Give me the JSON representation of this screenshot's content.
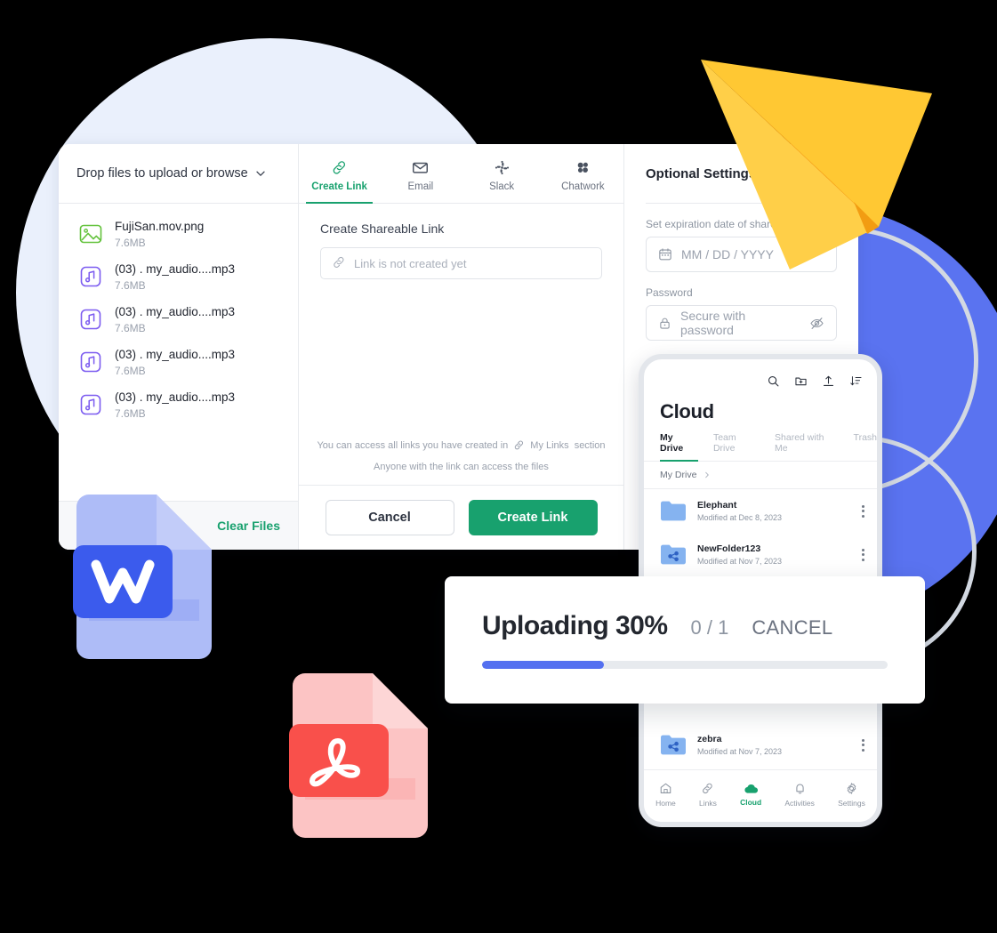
{
  "colors": {
    "brand_green": "#18a16e",
    "progress_blue": "#5470f0",
    "circle_blue": "#5a73f0",
    "circle_light": "#eaf0fc",
    "plane_yellow": "#ffc833",
    "word_blue": "#3b5bed",
    "pdf_red": "#f9504b"
  },
  "upload_panel": {
    "drop_label": "Drop files to upload or browse",
    "clear_files_label": "Clear Files",
    "files": [
      {
        "name": "FujiSan.mov.png",
        "size": "7.6MB",
        "icon": "image-file-icon"
      },
      {
        "name": "(03) . my_audio....mp3",
        "size": "7.6MB",
        "icon": "audio-file-icon"
      },
      {
        "name": "(03) . my_audio....mp3",
        "size": "7.6MB",
        "icon": "audio-file-icon"
      },
      {
        "name": "(03) . my_audio....mp3",
        "size": "7.6MB",
        "icon": "audio-file-icon"
      },
      {
        "name": "(03) . my_audio....mp3",
        "size": "7.6MB",
        "icon": "audio-file-icon"
      }
    ]
  },
  "share_panel": {
    "tabs": [
      {
        "label": "Create Link",
        "icon": "link-icon",
        "active": true
      },
      {
        "label": "Email",
        "icon": "envelope-icon",
        "active": false
      },
      {
        "label": "Slack",
        "icon": "slack-icon",
        "active": false
      },
      {
        "label": "Chatwork",
        "icon": "chatwork-icon",
        "active": false
      }
    ],
    "section_title": "Create Shareable Link",
    "link_placeholder": "Link is not created yet",
    "hint_prefix": "You can access all links you have created in",
    "hint_link": "My Links",
    "hint_suffix": "section",
    "hint_secondary": "Anyone with the link can access the files",
    "cancel_label": "Cancel",
    "create_label": "Create Link"
  },
  "optional_settings": {
    "title": "Optional Settings",
    "expiration_label": "Set expiration date of shared link",
    "expiration_placeholder": "MM / DD / YYYY",
    "password_label": "Password",
    "password_placeholder": "Secure with password"
  },
  "mobile": {
    "app_title": "Cloud",
    "top_icons": [
      "search-icon",
      "new-folder-icon",
      "upload-icon",
      "sort-icon"
    ],
    "tabs": [
      {
        "label": "My Drive",
        "active": true
      },
      {
        "label": "Team Drive",
        "active": false
      },
      {
        "label": "Shared with Me",
        "active": false
      },
      {
        "label": "Trash",
        "active": false
      }
    ],
    "breadcrumb": "My Drive",
    "rows": [
      {
        "name": "Elephant",
        "sub": "Modified at Dec 8, 2023",
        "icon": "folder-icon"
      },
      {
        "name": "NewFolder123",
        "sub": "Modified at Nov 7, 2023",
        "icon": "shared-folder-icon"
      },
      {
        "name": "zebra",
        "sub": "Modified at Nov 7, 2023",
        "icon": "shared-folder-icon"
      }
    ],
    "nav": [
      {
        "label": "Home",
        "icon": "home-icon",
        "active": false
      },
      {
        "label": "Links",
        "icon": "link-icon",
        "active": false
      },
      {
        "label": "Cloud",
        "icon": "cloud-icon",
        "active": true
      },
      {
        "label": "Activities",
        "icon": "bell-icon",
        "active": false
      },
      {
        "label": "Settings",
        "icon": "gear-icon",
        "active": false
      }
    ]
  },
  "uploading_toast": {
    "title": "Uploading 30%",
    "count": "0 / 1",
    "cancel_label": "CANCEL",
    "percent": 30
  }
}
